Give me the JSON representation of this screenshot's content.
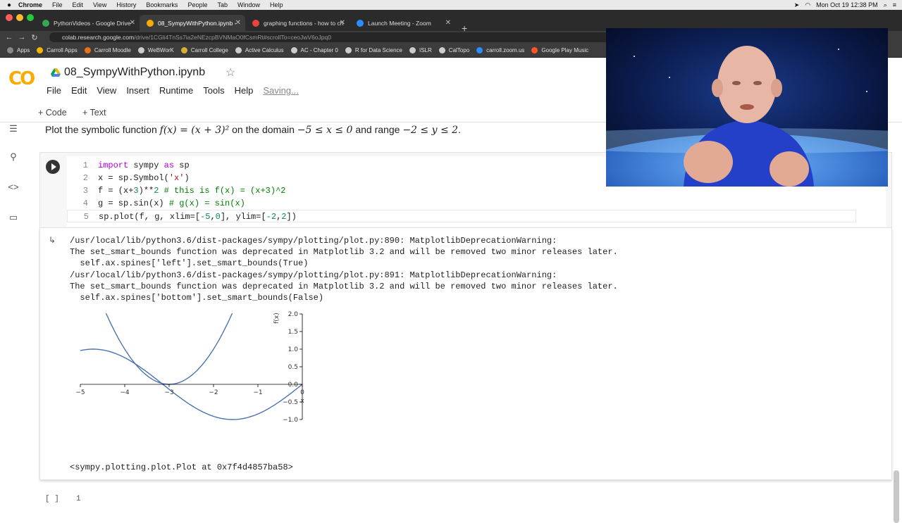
{
  "menubar": {
    "items": [
      "Chrome",
      "File",
      "Edit",
      "View",
      "History",
      "Bookmarks",
      "People",
      "Tab",
      "Window",
      "Help"
    ],
    "datetime": "Mon Oct 19  12:38 PM"
  },
  "tabs": [
    {
      "label": "PythonVideos - Google Drive",
      "color": "#34a853"
    },
    {
      "label": "08_SympyWithPython.ipynb -",
      "color": "#f9ab00"
    },
    {
      "label": "graphing functions - how to ch",
      "color": "#e8453c"
    },
    {
      "label": "Launch Meeting - Zoom",
      "color": "#2d8cff"
    }
  ],
  "url": {
    "host": "colab.research.google.com",
    "path": "/drive/1CGli4TnSs7ia2eNEzcpBVNMaO0fCsmRt#scrollTo=ceoJwV6oJpq0"
  },
  "bookmarks": [
    {
      "label": "Apps",
      "color": "#888888"
    },
    {
      "label": "Carroll Apps",
      "color": "#f4b400"
    },
    {
      "label": "Carroll Moodle",
      "color": "#e8711a"
    },
    {
      "label": "WeBWorK",
      "color": "#cccccc"
    },
    {
      "label": "Carroll College",
      "color": "#d4af37"
    },
    {
      "label": "Active Calculus",
      "color": "#cccccc"
    },
    {
      "label": "AC - Chapter 0",
      "color": "#cccccc"
    },
    {
      "label": "R for Data Science",
      "color": "#cccccc"
    },
    {
      "label": "ISLR",
      "color": "#cccccc"
    },
    {
      "label": "CalTopo",
      "color": "#cccccc"
    },
    {
      "label": "carroll.zoom.us",
      "color": "#2d8cff"
    },
    {
      "label": "Google Play Music",
      "color": "#ff5722"
    }
  ],
  "colab": {
    "logo": "CO",
    "title": "08_SympyWithPython.ipynb",
    "menus": [
      "File",
      "Edit",
      "View",
      "Insert",
      "Runtime",
      "Tools",
      "Help"
    ],
    "saving": "Saving...",
    "toolbar": {
      "code": "+ Code",
      "text": "+ Text"
    }
  },
  "text_cell": {
    "prefix": "Plot the symbolic function ",
    "fx": "f(x) = (x + 3)²",
    "mid": " on the domain ",
    "domain": "−5 ≤ x ≤ 0",
    "mid2": " and range ",
    "range": "−2 ≤ y ≤ 2",
    "suffix": "."
  },
  "code_lines": [
    {
      "n": "1"
    },
    {
      "n": "2"
    },
    {
      "n": "3"
    },
    {
      "n": "4"
    },
    {
      "n": "5"
    }
  ],
  "code_text": {
    "l1a": "import",
    "l1b": " sympy ",
    "l1c": "as",
    "l1d": " sp",
    "l2a": "x = sp.Symbol(",
    "l2b": "'x'",
    "l2c": ")",
    "l3a": "f = (x+",
    "l3b": "3",
    "l3c": ")**",
    "l3d": "2",
    "l3e": " # this is f(x) = (x+3)^2",
    "l4a": "g = sp.sin(x) ",
    "l4b": "# g(x) = sin(x)",
    "l5a": "sp.plot(f, g, xlim=[",
    "l5b": "-5",
    "l5c": ",",
    "l5d": "0",
    "l5e": "], ylim=[",
    "l5f": "-2",
    "l5g": ",",
    "l5h": "2",
    "l5i": "])"
  },
  "output": {
    "lines": [
      "/usr/local/lib/python3.6/dist-packages/sympy/plotting/plot.py:890: MatplotlibDeprecationWarning:",
      "The set_smart_bounds function was deprecated in Matplotlib 3.2 and will be removed two minor releases later.",
      "  self.ax.spines['left'].set_smart_bounds(True)",
      "/usr/local/lib/python3.6/dist-packages/sympy/plotting/plot.py:891: MatplotlibDeprecationWarning:",
      "The set_smart_bounds function was deprecated in Matplotlib 3.2 and will be removed two minor releases later.",
      "  self.ax.spines['bottom'].set_smart_bounds(False)"
    ],
    "result": "<sympy.plotting.plot.Plot at 0x7f4d4857ba58>"
  },
  "empty_cell": {
    "brackets": "[ ]",
    "line": "1"
  },
  "chart_data": {
    "type": "line",
    "xlabel": "x",
    "ylabel": "f(x)",
    "xlim": [
      -5,
      0
    ],
    "ylim": [
      -1,
      2
    ],
    "x_ticks": [
      "−5",
      "−4",
      "−3",
      "−2",
      "−1",
      "0"
    ],
    "y_ticks": [
      "2.0",
      "1.5",
      "1.0",
      "0.5",
      "0.0",
      "−0.5",
      "−1.0"
    ],
    "series": [
      {
        "expr": "(x+3)^2",
        "color": "#4c72b0",
        "domain": [
          -4.42,
          -1.58
        ]
      },
      {
        "expr": "sin(x)",
        "color": "#4c72b0",
        "domain": [
          -5,
          0
        ]
      }
    ]
  }
}
